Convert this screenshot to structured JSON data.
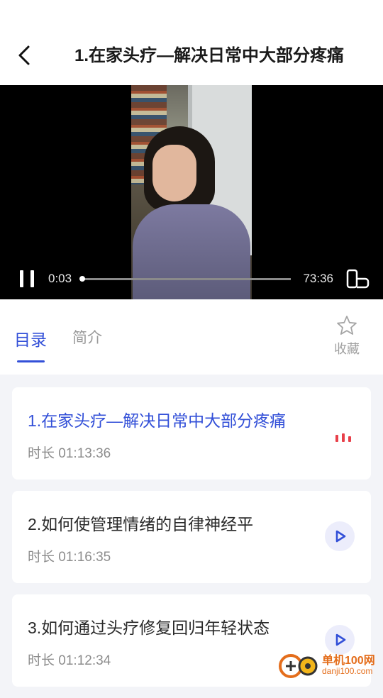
{
  "header": {
    "title": "1.在家头疗—解决日常中大部分疼痛",
    "back_icon": "chevron-left-icon"
  },
  "player": {
    "current_time": "0:03",
    "total_time": "73:36",
    "progress_fraction": 0.001,
    "pause_icon": "pause-icon",
    "fullscreen_icon": "fullscreen-icon"
  },
  "tabs": {
    "catalog": "目录",
    "intro": "简介",
    "active_color": "#3350d8"
  },
  "favorite": {
    "label": "收藏",
    "icon": "star-outline-icon"
  },
  "lessons": [
    {
      "title": "1.在家头疗—解决日常中大部分疼痛",
      "duration": "时长 01:13:36",
      "state": "playing",
      "indicator_icon": "equalizer-icon"
    },
    {
      "title": "2.如何使管理情绪的自律神经平",
      "duration": "时长 01:16:35",
      "state": "idle",
      "indicator_icon": "play-icon"
    },
    {
      "title": "3.如何通过头疗修复回归年轻状态",
      "duration": "时长 01:12:34",
      "state": "idle",
      "indicator_icon": "play-icon"
    }
  ],
  "watermark": {
    "brand": "单机100网",
    "url": "danji100.com"
  },
  "colors": {
    "accent": "#3350d8",
    "playing_indicator": "#e8404a",
    "watermark": "#e46e1c"
  }
}
